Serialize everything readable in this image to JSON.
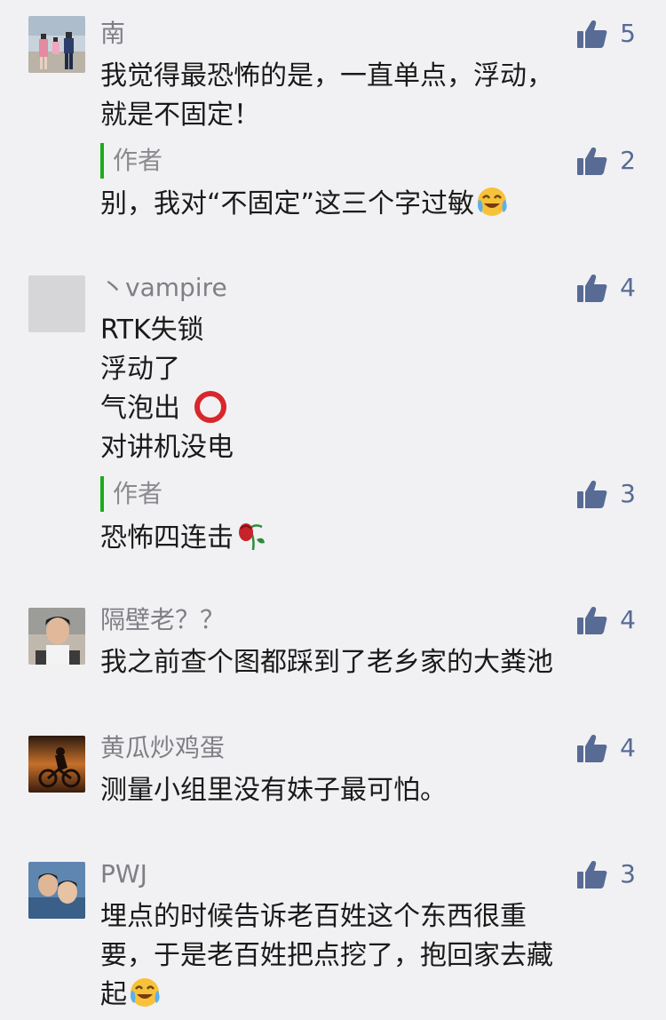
{
  "colors": {
    "background": "#f1f1f3",
    "like_blue": "#576b95",
    "author_bar": "#1aad19",
    "name_gray": "#7f7f86"
  },
  "comments": [
    {
      "name": "南",
      "likes": "5",
      "text": "我觉得最恐怖的是，一直单点，浮动，\n就是不固定！",
      "reply": {
        "author_label": "作者",
        "likes": "2",
        "text": "别，我对“不固定”这三个字过敏",
        "emoji": "crying-laughing-emoji"
      }
    },
    {
      "name": "丶vampire",
      "likes": "4",
      "text": "RTK失锁\n浮动了\n气泡出\n对讲机没电",
      "inline_icon": "red-circle-icon",
      "reply": {
        "author_label": "作者",
        "likes": "3",
        "text": "恐怖四连击",
        "emoji": "wilted-rose-emoji"
      }
    },
    {
      "name": "隔壁老？？",
      "likes": "4",
      "text": "我之前查个图都踩到了老乡家的大粪池"
    },
    {
      "name": "黄瓜炒鸡蛋",
      "likes": "4",
      "text": "测量小组里没有妹子最可怕。"
    },
    {
      "name": "PWJ",
      "likes": "3",
      "text": "埋点的时候告诉老百姓这个东西很重\n要，于是老百姓把点挖了，抱回家去藏\n起",
      "emoji": "crying-laughing-emoji"
    }
  ]
}
